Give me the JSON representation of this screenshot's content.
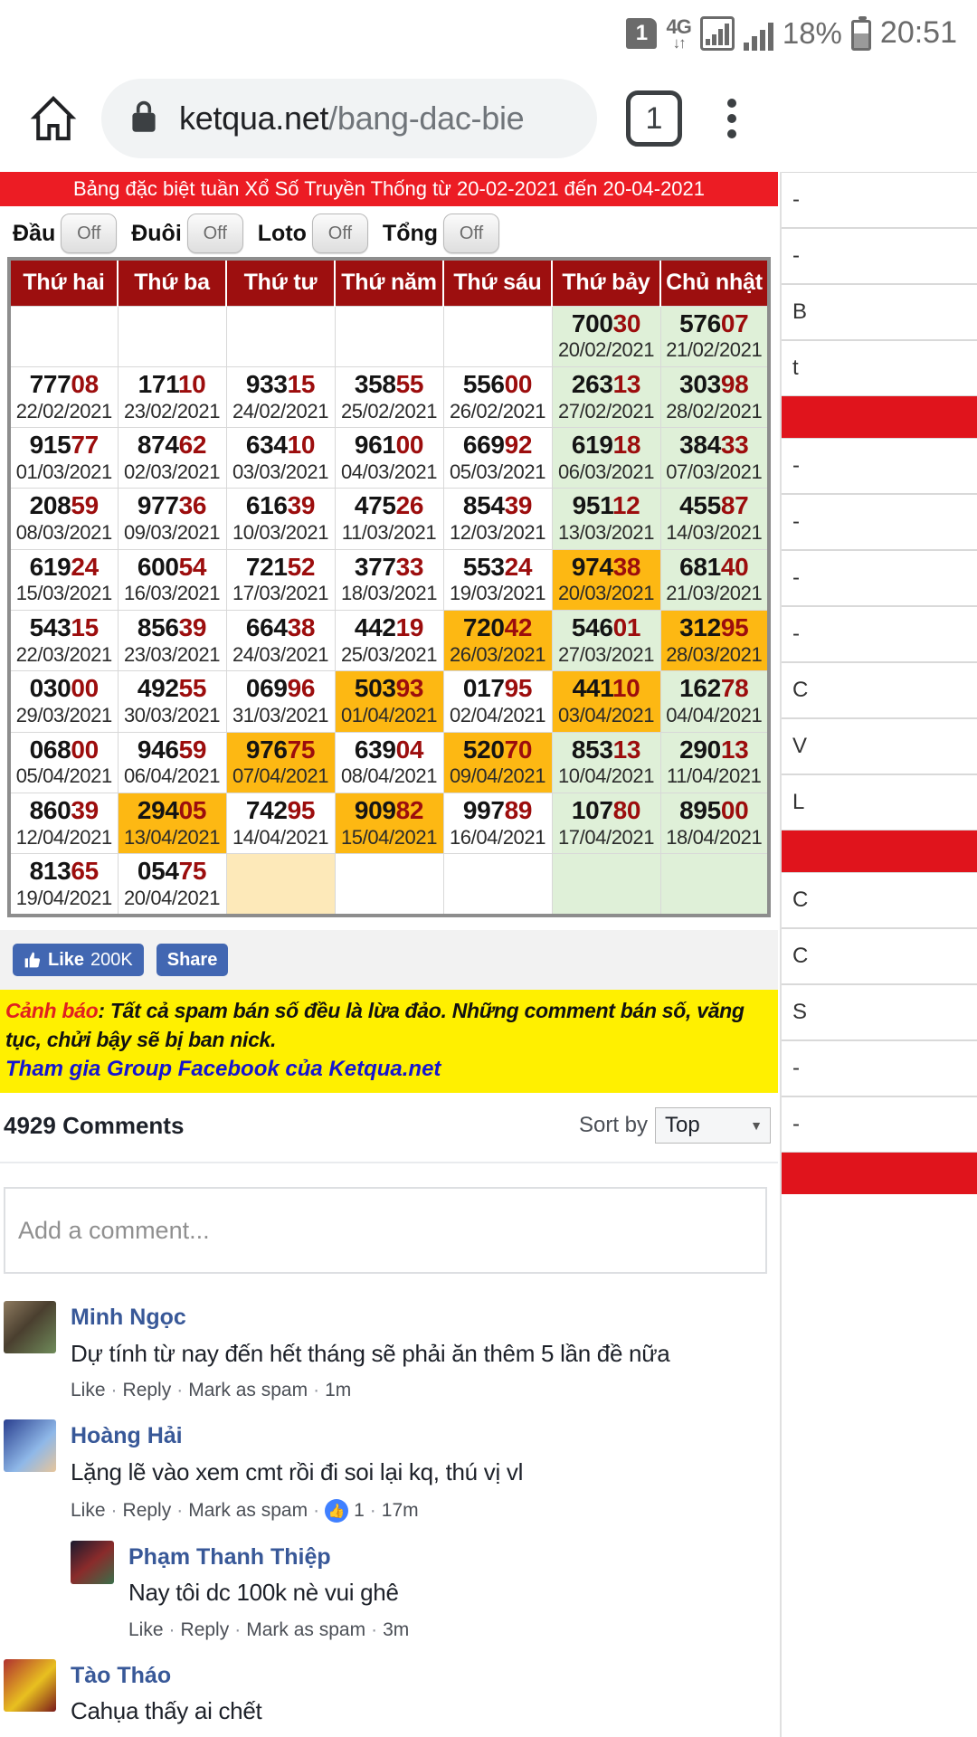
{
  "statusbar": {
    "sim_badge": "1",
    "network_type": "4G",
    "data_arrows": "↓↑",
    "battery_percent": "18%",
    "clock": "20:51"
  },
  "browser": {
    "home_icon": "home-icon",
    "lock_icon": "lock-icon",
    "url_domain": "ketqua.net",
    "url_path": "/bang-dac-bie",
    "tab_count": "1",
    "menu_icon": "kebab-menu-icon"
  },
  "banner": {
    "title": "Bảng đặc biệt tuần Xổ Số Truyền Thống từ 20-02-2021 đến 20-04-2021"
  },
  "toggles": [
    {
      "label": "Đầu",
      "state": "Off"
    },
    {
      "label": "Đuôi",
      "state": "Off"
    },
    {
      "label": "Loto",
      "state": "Off"
    },
    {
      "label": "Tổng",
      "state": "Off"
    }
  ],
  "table": {
    "headers": [
      "Thứ hai",
      "Thứ ba",
      "Thứ tư",
      "Thứ năm",
      "Thứ sáu",
      "Thứ bảy",
      "Chủ nhật"
    ],
    "rows": [
      [
        {
          "num": "",
          "date": "",
          "bg": "blank"
        },
        {
          "num": "",
          "date": "",
          "bg": "blank"
        },
        {
          "num": "",
          "date": "",
          "bg": "blank"
        },
        {
          "num": "",
          "date": "",
          "bg": "blank"
        },
        {
          "num": "",
          "date": "",
          "bg": "blank"
        },
        {
          "num": "70030",
          "date": "20/02/2021",
          "bg": "green"
        },
        {
          "num": "57607",
          "date": "21/02/2021",
          "bg": "green"
        }
      ],
      [
        {
          "num": "77708",
          "date": "22/02/2021",
          "bg": "blank"
        },
        {
          "num": "17110",
          "date": "23/02/2021",
          "bg": "blank"
        },
        {
          "num": "93315",
          "date": "24/02/2021",
          "bg": "blank"
        },
        {
          "num": "35855",
          "date": "25/02/2021",
          "bg": "blank"
        },
        {
          "num": "55600",
          "date": "26/02/2021",
          "bg": "blank"
        },
        {
          "num": "26313",
          "date": "27/02/2021",
          "bg": "green"
        },
        {
          "num": "30398",
          "date": "28/02/2021",
          "bg": "green"
        }
      ],
      [
        {
          "num": "91577",
          "date": "01/03/2021",
          "bg": "blank"
        },
        {
          "num": "87462",
          "date": "02/03/2021",
          "bg": "blank"
        },
        {
          "num": "63410",
          "date": "03/03/2021",
          "bg": "blank"
        },
        {
          "num": "96100",
          "date": "04/03/2021",
          "bg": "blank"
        },
        {
          "num": "66992",
          "date": "05/03/2021",
          "bg": "blank"
        },
        {
          "num": "61918",
          "date": "06/03/2021",
          "bg": "green"
        },
        {
          "num": "38433",
          "date": "07/03/2021",
          "bg": "green"
        }
      ],
      [
        {
          "num": "20859",
          "date": "08/03/2021",
          "bg": "blank"
        },
        {
          "num": "97736",
          "date": "09/03/2021",
          "bg": "blank"
        },
        {
          "num": "61639",
          "date": "10/03/2021",
          "bg": "blank"
        },
        {
          "num": "47526",
          "date": "11/03/2021",
          "bg": "blank"
        },
        {
          "num": "85439",
          "date": "12/03/2021",
          "bg": "blank"
        },
        {
          "num": "95112",
          "date": "13/03/2021",
          "bg": "green"
        },
        {
          "num": "45587",
          "date": "14/03/2021",
          "bg": "green"
        }
      ],
      [
        {
          "num": "61924",
          "date": "15/03/2021",
          "bg": "blank"
        },
        {
          "num": "60054",
          "date": "16/03/2021",
          "bg": "blank"
        },
        {
          "num": "72152",
          "date": "17/03/2021",
          "bg": "blank"
        },
        {
          "num": "37733",
          "date": "18/03/2021",
          "bg": "blank"
        },
        {
          "num": "55324",
          "date": "19/03/2021",
          "bg": "blank"
        },
        {
          "num": "97438",
          "date": "20/03/2021",
          "bg": "orange"
        },
        {
          "num": "68140",
          "date": "21/03/2021",
          "bg": "green"
        }
      ],
      [
        {
          "num": "54315",
          "date": "22/03/2021",
          "bg": "blank"
        },
        {
          "num": "85639",
          "date": "23/03/2021",
          "bg": "blank"
        },
        {
          "num": "66438",
          "date": "24/03/2021",
          "bg": "blank"
        },
        {
          "num": "44219",
          "date": "25/03/2021",
          "bg": "blank"
        },
        {
          "num": "72042",
          "date": "26/03/2021",
          "bg": "orange"
        },
        {
          "num": "54601",
          "date": "27/03/2021",
          "bg": "green"
        },
        {
          "num": "31295",
          "date": "28/03/2021",
          "bg": "orange"
        }
      ],
      [
        {
          "num": "03000",
          "date": "29/03/2021",
          "bg": "blank"
        },
        {
          "num": "49255",
          "date": "30/03/2021",
          "bg": "blank"
        },
        {
          "num": "06996",
          "date": "31/03/2021",
          "bg": "blank"
        },
        {
          "num": "50393",
          "date": "01/04/2021",
          "bg": "orange"
        },
        {
          "num": "01795",
          "date": "02/04/2021",
          "bg": "blank"
        },
        {
          "num": "44110",
          "date": "03/04/2021",
          "bg": "orange"
        },
        {
          "num": "16278",
          "date": "04/04/2021",
          "bg": "green"
        }
      ],
      [
        {
          "num": "06800",
          "date": "05/04/2021",
          "bg": "blank"
        },
        {
          "num": "94659",
          "date": "06/04/2021",
          "bg": "blank"
        },
        {
          "num": "97675",
          "date": "07/04/2021",
          "bg": "orange"
        },
        {
          "num": "63904",
          "date": "08/04/2021",
          "bg": "blank"
        },
        {
          "num": "52070",
          "date": "09/04/2021",
          "bg": "orange"
        },
        {
          "num": "85313",
          "date": "10/04/2021",
          "bg": "green"
        },
        {
          "num": "29013",
          "date": "11/04/2021",
          "bg": "green"
        }
      ],
      [
        {
          "num": "86039",
          "date": "12/04/2021",
          "bg": "blank"
        },
        {
          "num": "29405",
          "date": "13/04/2021",
          "bg": "orange"
        },
        {
          "num": "74295",
          "date": "14/04/2021",
          "bg": "blank"
        },
        {
          "num": "90982",
          "date": "15/04/2021",
          "bg": "orange"
        },
        {
          "num": "99789",
          "date": "16/04/2021",
          "bg": "blank"
        },
        {
          "num": "10780",
          "date": "17/04/2021",
          "bg": "green"
        },
        {
          "num": "89500",
          "date": "18/04/2021",
          "bg": "green"
        }
      ],
      [
        {
          "num": "81365",
          "date": "19/04/2021",
          "bg": "blank"
        },
        {
          "num": "05475",
          "date": "20/04/2021",
          "bg": "blank"
        },
        {
          "num": "",
          "date": "",
          "bg": "cream"
        },
        {
          "num": "",
          "date": "",
          "bg": "blank"
        },
        {
          "num": "",
          "date": "",
          "bg": "blank"
        },
        {
          "num": "",
          "date": "",
          "bg": "green"
        },
        {
          "num": "",
          "date": "",
          "bg": "green"
        }
      ]
    ]
  },
  "facebook_bar": {
    "like_label": "Like",
    "like_count": "200K",
    "share_label": "Share"
  },
  "warning": {
    "prefix": "Cảnh báo",
    "text": ": Tất cả spam bán số đều là lừa đảo. Những comment bán số, văng tục, chửi bậy sẽ bị ban nick.",
    "group_link": "Tham gia Group Facebook của Ketqua.net"
  },
  "comments": {
    "count_label": "4929 Comments",
    "sort_label": "Sort by",
    "sort_value": "Top",
    "input_placeholder": "Add a comment...",
    "items": [
      {
        "name": "Minh Ngọc",
        "text": "Dự tính từ nay đến hết tháng sẽ phải ăn thêm 5 lần đề nữa",
        "like": "Like",
        "reply": "Reply",
        "spam": "Mark as spam",
        "time": "1m",
        "likes": "",
        "reply_level": 0
      },
      {
        "name": "Hoàng Hải",
        "text": "Lặng lẽ vào xem cmt rồi đi soi lại kq, thú vị vl",
        "like": "Like",
        "reply": "Reply",
        "spam": "Mark as spam",
        "time": "17m",
        "likes": "1",
        "reply_level": 0
      },
      {
        "name": "Phạm Thanh Thiệp",
        "text": "Nay tôi dc 100k nè vui ghê",
        "like": "Like",
        "reply": "Reply",
        "spam": "Mark as spam",
        "time": "3m",
        "likes": "",
        "reply_level": 1
      },
      {
        "name": "Tào Tháo",
        "text": "Cahụa thấy ai chết",
        "like": "",
        "reply": "",
        "spam": "",
        "time": "",
        "likes": "",
        "reply_level": 0
      }
    ]
  },
  "colors": {
    "banner_red": "#ec1c24",
    "header_red": "#9d0f0f",
    "highlight_orange": "#fdb813",
    "weekend_green": "#dff0d8",
    "cream": "#fde9b9",
    "warning_yellow": "#fff000",
    "digit_red": "#9c0d0d",
    "fb_blue": "#4267b2",
    "link_blue": "#385898"
  }
}
